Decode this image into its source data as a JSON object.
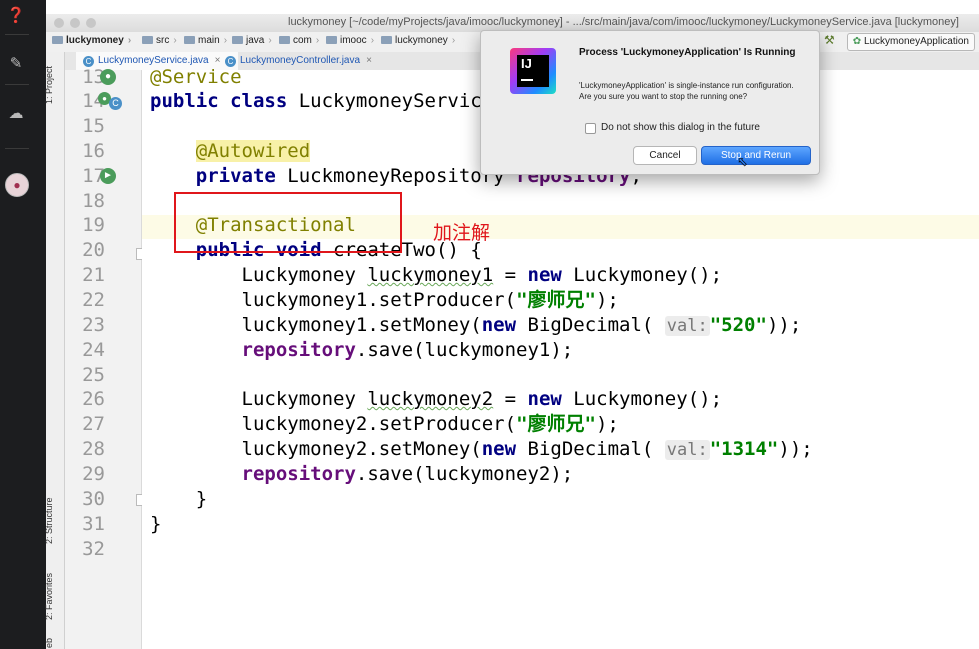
{
  "window": {
    "title": "luckymoney [~/code/myProjects/java/imooc/luckymoney] - .../src/main/java/com/imooc/luckymoney/LuckymoneyService.java [luckymoney]"
  },
  "breadcrumb": [
    "luckymoney",
    "src",
    "main",
    "java",
    "com",
    "imooc",
    "luckymoney"
  ],
  "run_config": "LuckymoneyApplication",
  "tabs": [
    {
      "label": "LuckymoneyService.java",
      "active": true
    },
    {
      "label": "LuckymoneyController.java",
      "active": false
    }
  ],
  "side_tools": {
    "project": "1: Project",
    "structure": "2: Structure",
    "favorites": "2: Favorites",
    "web": "eb"
  },
  "code": {
    "line_numbers": [
      "13",
      "14",
      "15",
      "16",
      "17",
      "18",
      "19",
      "20",
      "21",
      "22",
      "23",
      "24",
      "25",
      "26",
      "27",
      "28",
      "29",
      "30",
      "31",
      "32"
    ],
    "l13_ann": "@Service",
    "l14_kw": "public class",
    "l14_name": " LuckymoneyService {",
    "l16_ann": "@Autowired",
    "l17_kw": "private",
    "l17_type": " LuckmoneyRepository ",
    "l17_field": "repository",
    "l17_end": ";",
    "l19_ann": "@Transactional",
    "l20_kw": "public void",
    "l20_rest": " createTwo() {",
    "l21_a": "Luckymoney ",
    "l21_var": "luckymoney1",
    "l21_b": " = ",
    "l21_kw": "new",
    "l21_c": " Luckymoney();",
    "l22_a": "luckymoney1.setProducer(",
    "l22_str": "\"廖师兄\"",
    "l22_b": ");",
    "l23_a": "luckymoney1.setMoney(",
    "l23_kw": "new",
    "l23_b": " BigDecimal( ",
    "l23_hint": "val:",
    "l23_str": "\"520\"",
    "l23_c": "));",
    "l24_field": "repository",
    "l24_b": ".save(luckymoney1);",
    "l26_a": "Luckymoney ",
    "l26_var": "luckymoney2",
    "l26_b": " = ",
    "l26_kw": "new",
    "l26_c": " Luckymoney();",
    "l27_a": "luckymoney2.setProducer(",
    "l27_str": "\"廖师兄\"",
    "l27_b": ");",
    "l28_a": "luckymoney2.setMoney(",
    "l28_kw": "new",
    "l28_b": " BigDecimal( ",
    "l28_hint": "val:",
    "l28_str": "\"1314\"",
    "l28_c": "));",
    "l29_field": "repository",
    "l29_b": ".save(luckymoney2);",
    "l30": "}",
    "l31": "}"
  },
  "annotation_note": "加注解",
  "dialog": {
    "title": "Process 'LuckymoneyApplication' Is Running",
    "message_line1": "'LuckymoneyApplication' is single-instance run configuration.",
    "message_line2": "Are you sure you want to stop the running one?",
    "checkbox_label": "Do not show this dialog in the future",
    "cancel": "Cancel",
    "primary": "Stop and Rerun"
  },
  "icons": {
    "c_badge": "C",
    "hammer": "hammer-icon",
    "help": "help-icon",
    "edit": "edit-icon",
    "cloud": "cloud-icon",
    "run_gutter": "run-icon"
  },
  "colors": {
    "keyword": "#000080",
    "annotation": "#808000",
    "string": "#008000",
    "field": "#660e7a",
    "highlight_box": "#e0161b",
    "primary_button": "#1f6fe5"
  }
}
